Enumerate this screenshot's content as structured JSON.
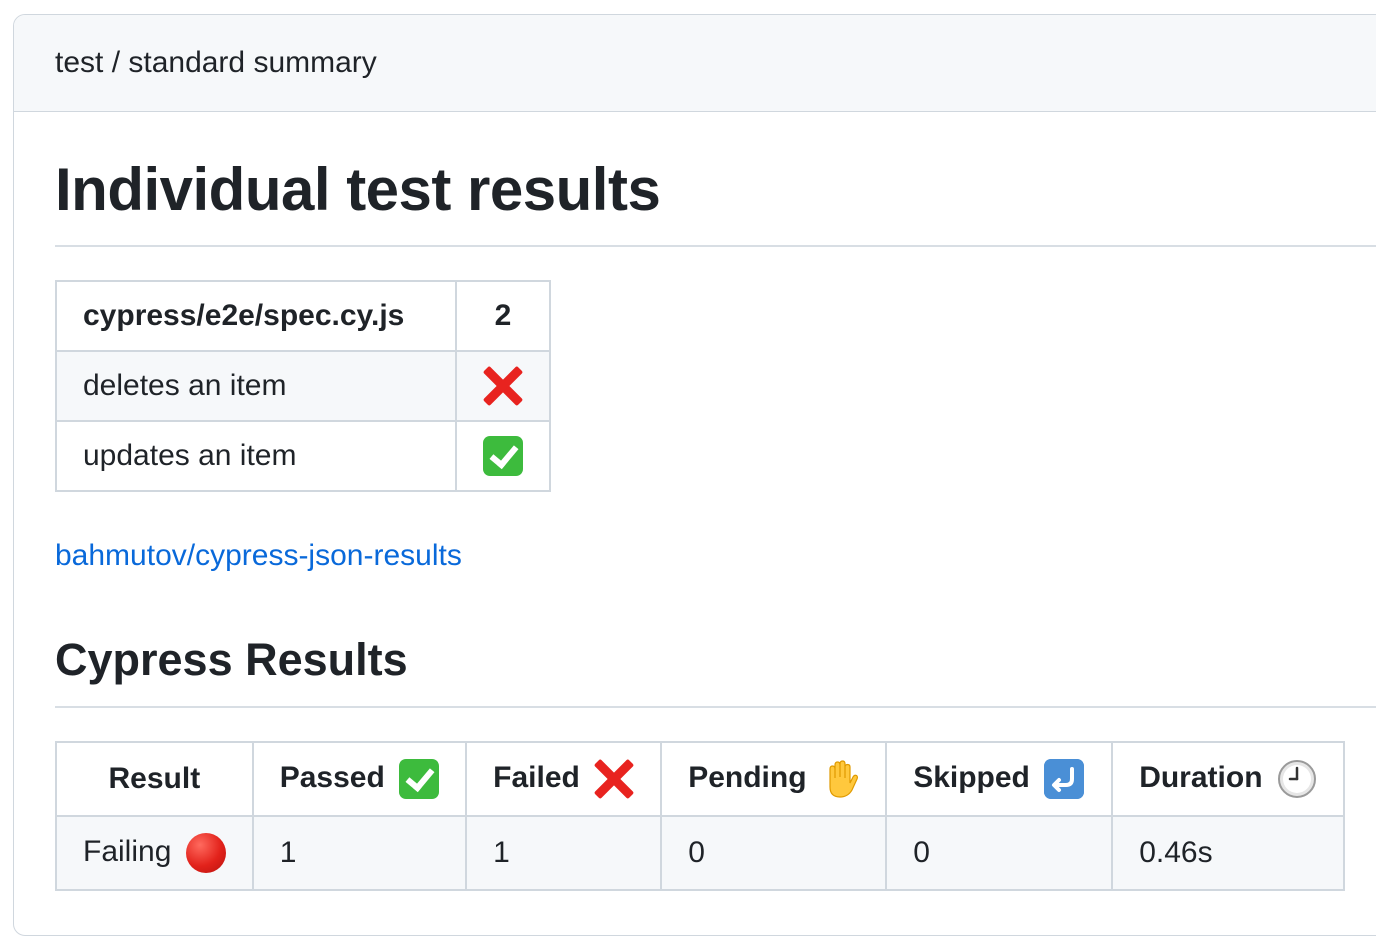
{
  "header": {
    "title": "test / standard summary"
  },
  "main": {
    "title": "Individual test results",
    "spec_table": {
      "header": {
        "file": "cypress/e2e/spec.cy.js",
        "count": "2"
      },
      "rows": [
        {
          "name": "deletes an item",
          "status": "failed",
          "status_icon": "cross-mark-icon"
        },
        {
          "name": "updates an item",
          "status": "passed",
          "status_icon": "check-mark-icon"
        }
      ]
    },
    "link": {
      "text": "bahmutov/cypress-json-results"
    },
    "results_title": "Cypress Results",
    "results_table": {
      "headers": {
        "result": "Result",
        "passed": "Passed",
        "failed": "Failed",
        "pending": "Pending",
        "skipped": "Skipped",
        "duration": "Duration"
      },
      "row": {
        "result": "Failing",
        "passed": "1",
        "failed": "1",
        "pending": "0",
        "skipped": "0",
        "duration": "0.46s"
      }
    }
  },
  "colors": {
    "link": "#0969da",
    "fail": "#e8231f",
    "pass": "#3dbb3d",
    "border": "#d0d7de",
    "header_bg": "#f6f8fa"
  }
}
